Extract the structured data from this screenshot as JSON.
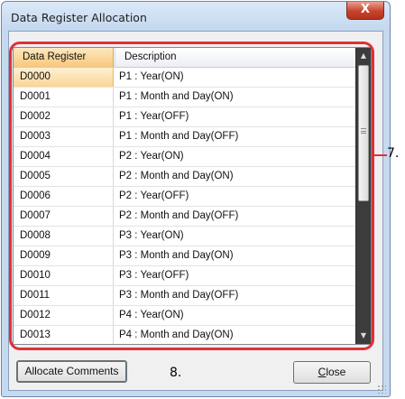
{
  "window": {
    "title": "Data Register Allocation",
    "close_glyph": "X"
  },
  "grid": {
    "headers": [
      "Data Register",
      "Description"
    ],
    "rows": [
      {
        "register": "D0000",
        "description": "P1 : Year(ON)"
      },
      {
        "register": "D0001",
        "description": "P1 : Month and Day(ON)"
      },
      {
        "register": "D0002",
        "description": "P1 : Year(OFF)"
      },
      {
        "register": "D0003",
        "description": "P1 : Month and Day(OFF)"
      },
      {
        "register": "D0004",
        "description": "P2 : Year(ON)"
      },
      {
        "register": "D0005",
        "description": "P2 : Month and Day(ON)"
      },
      {
        "register": "D0006",
        "description": "P2 : Year(OFF)"
      },
      {
        "register": "D0007",
        "description": "P2 : Month and Day(OFF)"
      },
      {
        "register": "D0008",
        "description": "P3 : Year(ON)"
      },
      {
        "register": "D0009",
        "description": "P3 : Month and Day(ON)"
      },
      {
        "register": "D0010",
        "description": "P3 : Year(OFF)"
      },
      {
        "register": "D0011",
        "description": "P3 : Month and Day(OFF)"
      },
      {
        "register": "D0012",
        "description": "P4 : Year(ON)"
      },
      {
        "register": "D0013",
        "description": "P4 : Month and Day(ON)"
      }
    ],
    "selected_row": 0,
    "scroll_up_glyph": "▲",
    "scroll_down_glyph": "▼"
  },
  "buttons": {
    "allocate_label": "Allocate Comments",
    "close_mnemonic": "C",
    "close_rest": "lose"
  },
  "callouts": {
    "grid_marker": "7.",
    "button_marker": "8."
  },
  "colors": {
    "highlight_frame": "#e0303a",
    "selected_cell": "#fbd595",
    "scrollbar_track": "#3c3c3c"
  }
}
